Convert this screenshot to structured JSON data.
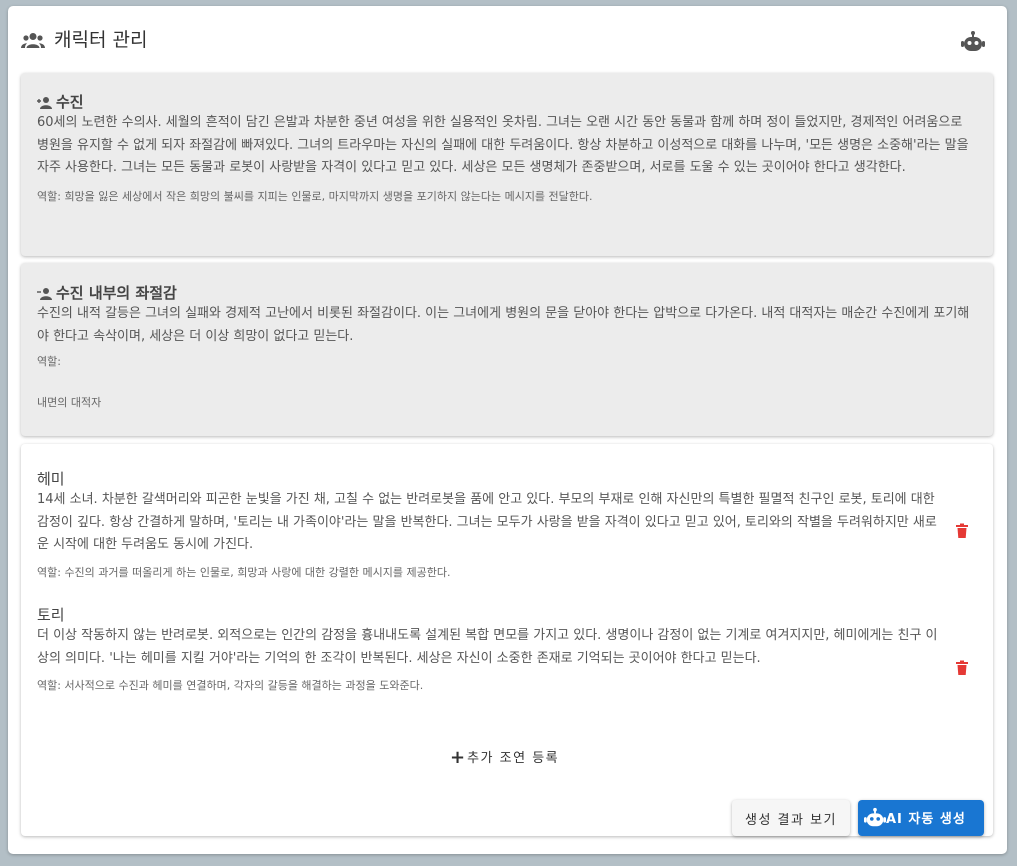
{
  "header": {
    "title": "캐릭터 관리",
    "title_icon": "group-icon",
    "bot_icon": "robot-icon"
  },
  "cards": [
    {
      "title": "수진",
      "description": "60세의 노련한 수의사. 세월의 흔적이 담긴 은발과 차분한 중년 여성을 위한 실용적인 옷차림. 그녀는 오랜 시간 동안 동물과 함께 하며 정이 들었지만, 경제적인 어려움으로 병원을 유지할 수 없게 되자 좌절감에 빠져있다. 그녀의 트라우마는 자신의 실패에 대한 두려움이다. 항상 차분하고 이성적으로 대화를 나누며, '모든 생명은 소중해'라는 말을 자주 사용한다. 그녀는 모든 동물과 로봇이 사랑받을 자격이 있다고 믿고 있다. 세상은 모든 생명체가 존중받으며, 서로를 도울 수 있는 곳이어야 한다고 생각한다.",
      "role": "역할: 희망을 잃은 세상에서 작은 희망의 불씨를 지피는 인물로, 마지막까지 생명을 포기하지 않는다는 메시지를 전달한다."
    },
    {
      "title": "수진 내부의 좌절감",
      "description": "수진의 내적 갈등은 그녀의 실패와 경제적 고난에서 비롯된 좌절감이다. 이는 그녀에게 병원의 문을 닫아야 한다는 압박으로 다가온다. 내적 대적자는 매순간 수진에게 포기해야 한다고 속삭이며, 세상은 더 이상 희망이 없다고 믿는다.",
      "role_label": "역할:",
      "role_value": "내면의 대적자"
    }
  ],
  "supporting": [
    {
      "name": "헤미",
      "description": "14세 소녀. 차분한 갈색머리와 피곤한 눈빛을 가진 채, 고칠 수 없는 반려로봇을 품에 안고 있다. 부모의 부재로 인해 자신만의 특별한 필멸적 친구인 로봇, 토리에 대한 감정이 깊다. 항상 간결하게 말하며, '토리는 내 가족이야'라는 말을 반복한다. 그녀는 모두가 사랑을 받을 자격이 있다고 믿고 있어, 토리와의 작별을 두려워하지만 새로운 시작에 대한 두려움도 동시에 가진다.",
      "role": "역할: 수진의 과거를 떠올리게 하는 인물로, 희망과 사랑에 대한 강렬한 메시지를 제공한다."
    },
    {
      "name": "토리",
      "description": "더 이상 작동하지 않는 반려로봇. 외적으로는 인간의 감정을 흉내내도록 설계된 복합 면모를 가지고 있다. 생명이나 감정이 없는 기계로 여겨지지만, 헤미에게는 친구 이상의 의미다. '나는 헤미를 지킬 거야'라는 기억의 한 조각이 반복된다. 세상은 자신이 소중한 존재로 기억되는 곳이어야 한다고 믿는다.",
      "role": "역할: 서사적으로 수진과 헤미를 연결하며, 각자의 갈등을 해결하는 과정을 도와준다."
    }
  ],
  "add_label": "추가 조연 등록",
  "buttons": {
    "result": "생성 결과 보기",
    "ai": "AI 자동 생성"
  },
  "colors": {
    "accent": "#1976d2",
    "delete": "#e53935",
    "card_bg": "#ececec",
    "frame": "#b3bfc6"
  }
}
